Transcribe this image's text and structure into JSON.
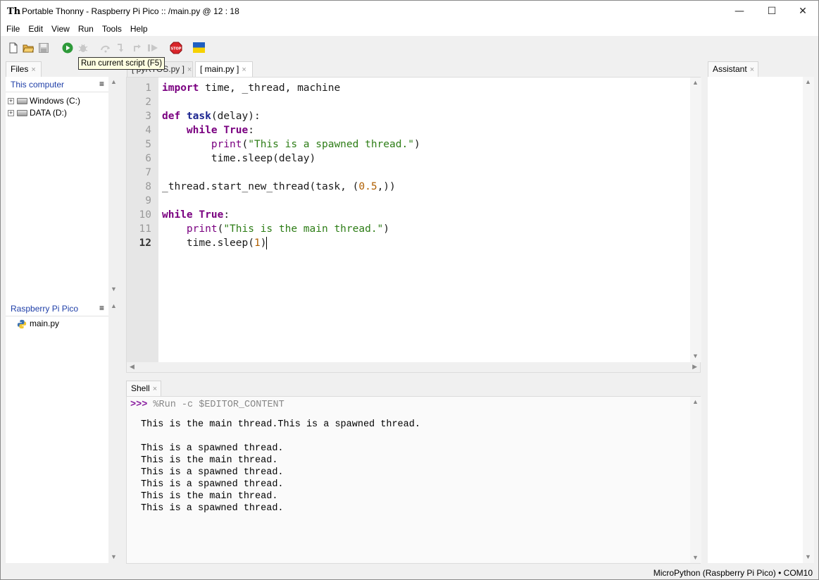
{
  "window": {
    "title": "Portable Thonny  -  Raspberry Pi Pico :: /main.py  @  12 : 18",
    "minimize_glyph": "—",
    "maximize_glyph": "☐",
    "close_glyph": "✕"
  },
  "menu": [
    "File",
    "Edit",
    "View",
    "Run",
    "Tools",
    "Help"
  ],
  "toolbar": {
    "icons": [
      "new-file-icon",
      "open-folder-icon",
      "save-icon",
      "run-icon",
      "debug-icon",
      "step-over-icon",
      "step-into-icon",
      "step-out-icon",
      "resume-icon",
      "stop-icon",
      "ukraine-flag-icon"
    ],
    "stop_label": "STOP",
    "tooltip": "Run current script (F5)"
  },
  "files_panel": {
    "tab_label": "Files",
    "this_computer": {
      "label": "This computer",
      "menu_glyph": "≡",
      "drives": [
        {
          "label": "Windows (C:)",
          "expander": "+"
        },
        {
          "label": "DATA (D:)",
          "expander": "+"
        }
      ]
    },
    "device": {
      "label": "Raspberry Pi Pico",
      "menu_glyph": "≡",
      "files": [
        "main.py"
      ]
    }
  },
  "editor": {
    "tabs": [
      {
        "label": "[ pyRTOS.py ]",
        "close": "×"
      },
      {
        "label": "[ main.py ]",
        "close": "×"
      }
    ],
    "line_numbers": [
      "1",
      "2",
      "3",
      "4",
      "5",
      "6",
      "7",
      "8",
      "9",
      "10",
      "11",
      "12"
    ],
    "current_line": 12,
    "lines": [
      "import time, _thread, machine",
      "",
      "def task(delay):",
      "    while True:",
      "        print(\"This is a spawned thread.\")",
      "        time.sleep(delay)",
      "",
      "_thread.start_new_thread(task, (0.5,))",
      "",
      "while True:",
      "    print(\"This is the main thread.\")",
      "    time.sleep(1)"
    ]
  },
  "shell": {
    "tab_label": "Shell",
    "close": "×",
    "prompt": ">>>",
    "command": "%Run -c $EDITOR_CONTENT",
    "output": [
      "This is the main thread.This is a spawned thread.",
      "",
      "This is a spawned thread.",
      "This is the main thread.",
      "This is a spawned thread.",
      "This is a spawned thread.",
      "This is the main thread.",
      "This is a spawned thread."
    ]
  },
  "assistant": {
    "tab_label": "Assistant",
    "close": "×"
  },
  "statusbar": {
    "interpreter": "MicroPython (Raspberry Pi Pico)",
    "separator": "•",
    "port": "COM10"
  }
}
